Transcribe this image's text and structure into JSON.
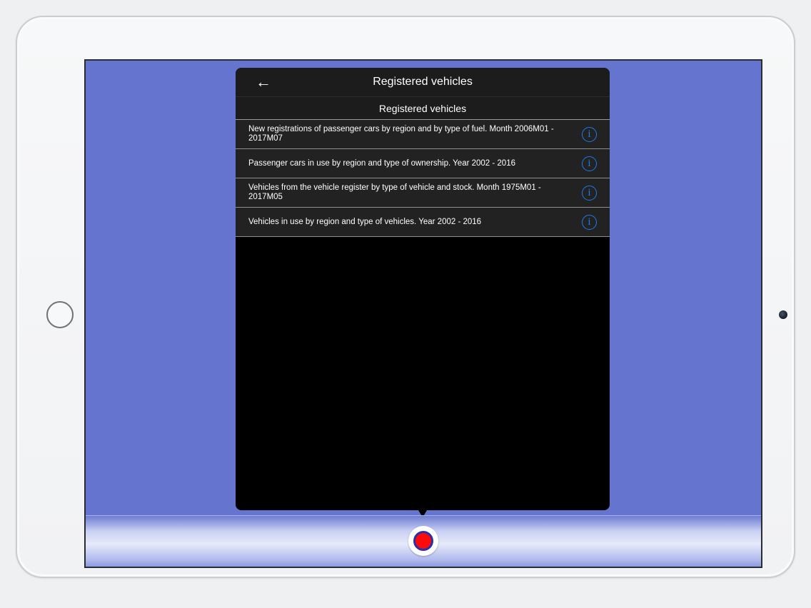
{
  "popover": {
    "nav_title": "Registered vehicles",
    "back_icon": "back-arrow-icon",
    "section_header": "Registered vehicles",
    "items": [
      {
        "label": "New registrations of passenger cars by region and by type of fuel. Month 2006M01 - 2017M07",
        "icon": "info-icon"
      },
      {
        "label": "Passenger cars in use by region and type of ownership. Year 2002 - 2016",
        "icon": "info-icon"
      },
      {
        "label": "Vehicles from the vehicle register by type of vehicle and stock. Month 1975M01 - 2017M05",
        "icon": "info-icon"
      },
      {
        "label": "Vehicles in use by region and type of vehicles. Year 2002 - 2016",
        "icon": "info-icon"
      }
    ]
  },
  "bottom_bar": {
    "record_icon": "record-icon"
  },
  "colors": {
    "screen_background": "#6474cf",
    "popover_background": "#000000",
    "row_background": "#222222",
    "info_accent": "#1f7be8",
    "record_red": "#ff0a0a",
    "record_ring": "#2b2fa8"
  },
  "glyphs": {
    "back_arrow": "←",
    "info": "i"
  }
}
